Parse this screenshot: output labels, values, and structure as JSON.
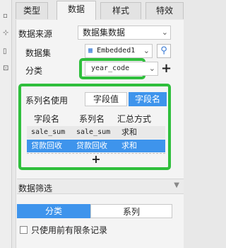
{
  "tabs": [
    "类型",
    "数据",
    "样式",
    "特效"
  ],
  "active_tab": 1,
  "data_source": {
    "label": "数据来源",
    "value": "数据集数据"
  },
  "dataset": {
    "label": "数据集",
    "value": "Embedded1",
    "icon": "table-icon",
    "search_icon": "search-icon"
  },
  "category": {
    "label": "分类",
    "value": "year_code"
  },
  "series_name": {
    "label": "系列名使用",
    "options": [
      "字段值",
      "字段名"
    ],
    "selected": 1,
    "columns": [
      "字段名",
      "系列名",
      "汇总方式"
    ],
    "rows": [
      [
        "sale_sum",
        "sale_sum",
        "求和"
      ],
      [
        "贷款回收",
        "贷款回收",
        "求和"
      ]
    ],
    "selected_row": 1,
    "add_label": "+"
  },
  "filter": {
    "label": "数据筛选"
  },
  "bottom_tabs": [
    "分类",
    "系列"
  ],
  "bottom_active": 0,
  "checkboxes": [
    {
      "label": "只使用前有限条记录",
      "checked": false
    }
  ],
  "colors": {
    "accent": "#3e94ec",
    "highlight": "#2fbf3c"
  }
}
